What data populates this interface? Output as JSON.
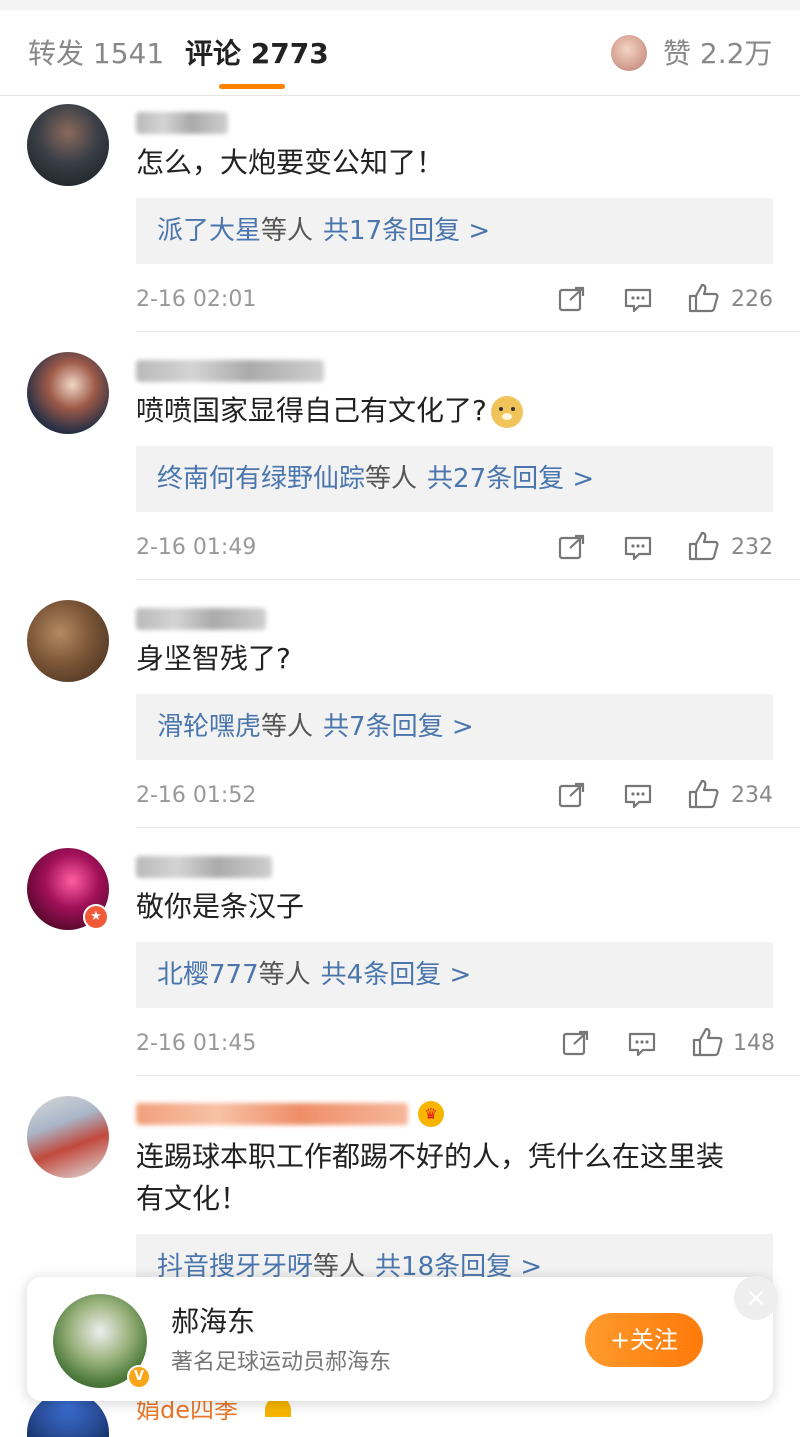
{
  "tabs": {
    "repost": "转发 1541",
    "comments": "评论 2773",
    "likes": "赞 2.2万"
  },
  "comments": [
    {
      "text": "怎么，大炮要变公知了！",
      "reply_names": "派了大星",
      "reply_etal": "等人",
      "reply_count": "共17条回复 >",
      "time": "2-16 02:01",
      "likes": "226"
    },
    {
      "text": "喷喷国家显得自己有文化了?",
      "reply_names": "终南何有绿野仙踪",
      "reply_etal": "等人",
      "reply_count": "共27条回复 >",
      "time": "2-16 01:49",
      "likes": "232"
    },
    {
      "text": "身坚智残了?",
      "reply_names": "滑轮嘿虎",
      "reply_etal": "等人",
      "reply_count": "共7条回复 >",
      "time": "2-16 01:52",
      "likes": "234"
    },
    {
      "text": "敬你是条汉子",
      "reply_names": "北樱777",
      "reply_etal": "等人",
      "reply_count": "共4条回复 >",
      "time": "2-16 01:45",
      "likes": "148"
    },
    {
      "text_line1": "连踢球本职工作都踢不好的人，凭什么在这里装",
      "text_line2": "有文化！",
      "reply_names": "抖音搜牙牙呀",
      "reply_etal": "等人",
      "reply_count": "共18条回复 >"
    }
  ],
  "next_comment_name": "娟de四季",
  "profile_card": {
    "name": "郝海东",
    "description": "著名足球运动员郝海东",
    "follow_label": "+关注",
    "close": "×"
  },
  "icons": {
    "share": "share-icon",
    "comment": "comment-icon",
    "like": "thumbs-up-icon",
    "crown": "crown-icon",
    "star": "star-icon",
    "verified": "verified-v-icon"
  },
  "colors": {
    "accent": "#ff8200",
    "link": "#4a76ad",
    "follow_button": "#ff8a1a"
  }
}
